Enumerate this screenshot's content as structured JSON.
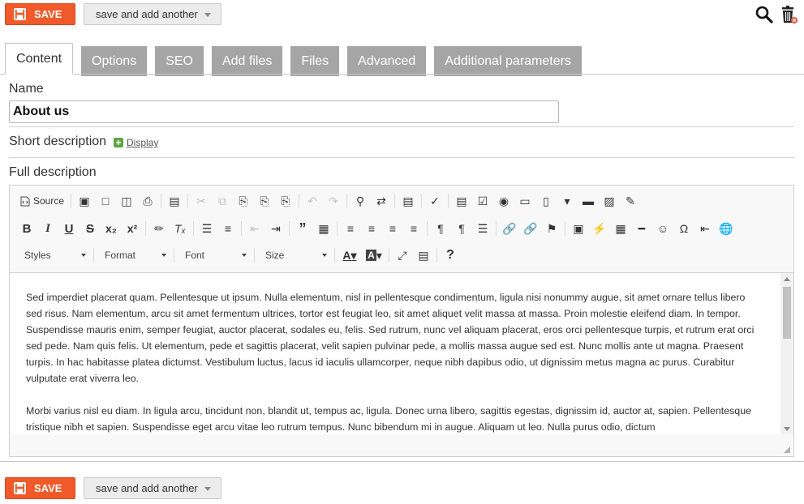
{
  "top_bar": {
    "save_label": "SAVE",
    "save_and_add_label": "save and add another",
    "search_icon": "search-icon",
    "delete_icon": "trash-icon"
  },
  "tabs": [
    {
      "label": "Content",
      "active": true
    },
    {
      "label": "Options",
      "active": false
    },
    {
      "label": "SEO",
      "active": false
    },
    {
      "label": "Add files",
      "active": false
    },
    {
      "label": "Files",
      "active": false
    },
    {
      "label": "Advanced",
      "active": false
    },
    {
      "label": "Additional parameters",
      "active": false
    }
  ],
  "form": {
    "name_label": "Name",
    "name_value": "About us",
    "short_description_label": "Short description",
    "display_link": "Display",
    "full_description_label": "Full description"
  },
  "editor": {
    "source_label": "Source",
    "combos": {
      "styles": "Styles",
      "format": "Format",
      "font": "Font",
      "size": "Size"
    },
    "paragraphs": [
      "Sed imperdiet placerat quam. Pellentesque ut ipsum. Nulla elementum, nisl in pellentesque condimentum, ligula nisi nonummy augue, sit amet ornare tellus libero sed risus. Nam elementum, arcu sit amet fermentum ultrices, tortor est feugiat leo, sit amet aliquet velit massa at massa. Proin molestie eleifend diam. In tempor. Suspendisse mauris enim, semper feugiat, auctor placerat, sodales eu, felis. Sed rutrum, nunc vel aliquam placerat, eros orci pellentesque turpis, et rutrum erat orci sed pede. Nam quis felis. Ut elementum, pede et sagittis placerat, velit sapien pulvinar pede, a mollis massa augue sed est. Nunc mollis ante ut magna. Praesent turpis. In hac habitasse platea dictumst. Vestibulum luctus, lacus id iaculis ullamcorper, neque nibh dapibus odio, ut dignissim metus magna ac purus. Curabitur vulputate erat viverra leo.",
      "Morbi varius nisl eu diam. In ligula arcu, tincidunt non, blandit ut, tempus ac, ligula. Donec urna libero, sagittis egestas, dignissim id, auctor at, sapien. Pellentesque tristique nibh et sapien. Suspendisse eget arcu vitae leo rutrum tempus. Nunc bibendum mi in augue. Aliquam ut leo. Nulla purus odio, dictum"
    ]
  },
  "bottom_bar": {
    "save_label": "SAVE",
    "save_and_add_label": "save and add another"
  },
  "colors": {
    "accent": "#f05a2a",
    "tab_inactive": "#a5a5a5",
    "add_green": "#5ca544"
  }
}
